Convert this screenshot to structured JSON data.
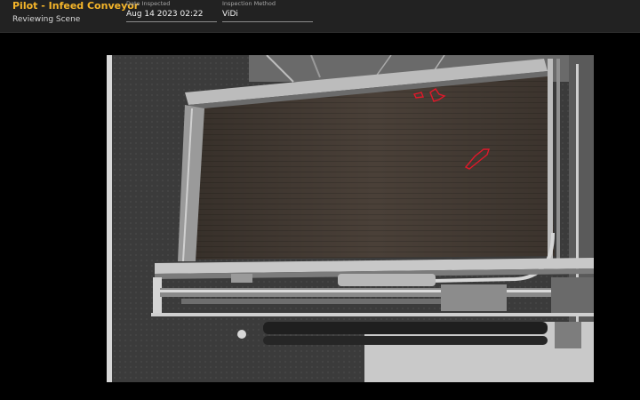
{
  "header": {
    "title": "Pilot - Infeed Conveyor",
    "subtitle": "Reviewing Scene",
    "date_inspected": {
      "label": "Date Inspected",
      "value": "Aug 14 2023 02:22"
    },
    "inspection_method": {
      "label": "Inspection Method",
      "value": "ViDi"
    }
  },
  "colors": {
    "accent": "#f5b52a",
    "header_bg": "#222222",
    "defect_outline": "#e0182a"
  },
  "viewer": {
    "defect_count": 3
  }
}
